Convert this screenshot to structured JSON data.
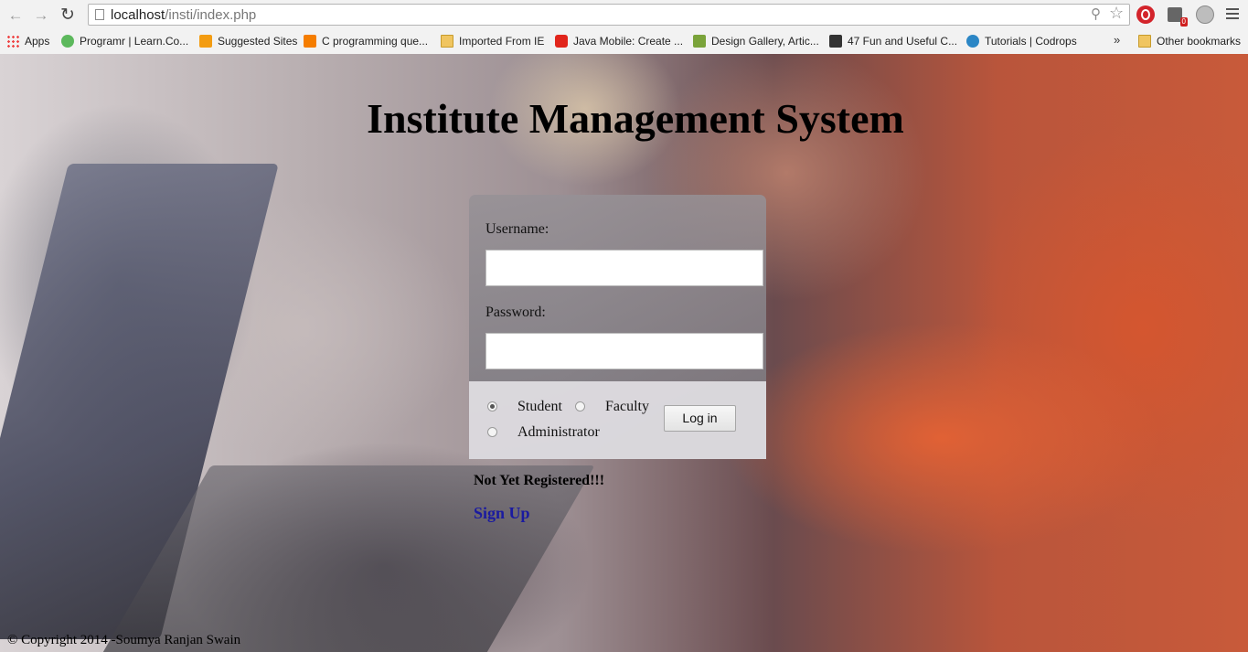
{
  "browser": {
    "url_host": "localhost",
    "url_path": "/insti/index.php",
    "bookmarks": [
      {
        "label": "Apps",
        "icon": "apps-grid-icon"
      },
      {
        "label": "Programr | Learn.Co...",
        "icon": "programr-icon",
        "color": "#5cb85c"
      },
      {
        "label": "Suggested Sites",
        "icon": "suggested-sites-icon",
        "color": "#f39c12"
      },
      {
        "label": "C programming que...",
        "icon": "blogger-icon",
        "color": "#f57d00"
      },
      {
        "label": "Imported From IE",
        "icon": "folder-icon"
      },
      {
        "label": "Java Mobile: Create ...",
        "icon": "oracle-icon",
        "color": "#e1251b"
      },
      {
        "label": "Design Gallery, Artic...",
        "icon": "design-gallery-icon",
        "color": "#7aa33a"
      },
      {
        "label": "47 Fun and Useful C...",
        "icon": "article-icon",
        "color": "#333333"
      },
      {
        "label": "Tutorials | Codrops",
        "icon": "codrops-icon",
        "color": "#2b86c5"
      },
      {
        "label": "Other bookmarks",
        "icon": "folder-icon"
      }
    ],
    "bookmarks_overflow": "»",
    "extension_badge": "0"
  },
  "page": {
    "title": "Institute Management System",
    "form": {
      "username_label": "Username:",
      "username_value": "",
      "password_label": "Password:",
      "password_value": "",
      "roles": [
        {
          "label": "Student",
          "checked": true
        },
        {
          "label": "Faculty",
          "checked": false
        },
        {
          "label": "Administrator",
          "checked": false
        }
      ],
      "login_button": "Log in"
    },
    "not_registered": "Not Yet Registered!!!",
    "signup_link": "Sign Up",
    "footer": "© Copyright 2014 -Soumya Ranjan Swain"
  }
}
